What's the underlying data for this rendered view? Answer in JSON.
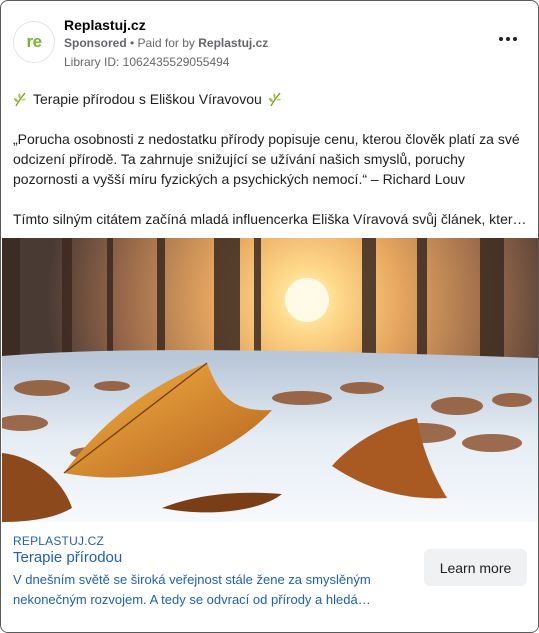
{
  "header": {
    "avatar_text": "re",
    "page_name": "Replastuj.cz",
    "sponsored": "Sponsored",
    "separator": " • ",
    "paid_for_prefix": "Paid for by ",
    "paid_for_name": "Replastuj.cz",
    "library_id": "Library ID: 1062435529055494",
    "more_icon": "ellipsis-icon"
  },
  "post": {
    "headline": "Terapie přírodou s Eliškou Víravovou",
    "headline_icon": "herb-icon",
    "quote": "„Porucha osobnosti z nedostatku přírody popisuje cenu, kterou člověk platí za své odcizení přírodě. Ta zahrnuje snižující se užívání našich smyslů, poruchy pozornosti a vyšší míru fyzických a psychických nemocí.“ – Richard Louv",
    "lead": "Tímto silným citátem začíná mladá influencerka Eliška Víravová svůj článek, který…"
  },
  "link_preview": {
    "domain": "REPLASTUJ.CZ",
    "title": "Terapie přírodou",
    "description_line1": "V dnešním světě se široká veřejnost stále žene za smyslěným",
    "description_line2": "nekonečným rozvojem. A tedy se odvrací od přírody a hledá…",
    "cta_label": "Learn more"
  },
  "colors": {
    "link_blue": "#1f5fb5",
    "brand_green": "#78b62c",
    "cta_bg": "#eff1f3"
  }
}
